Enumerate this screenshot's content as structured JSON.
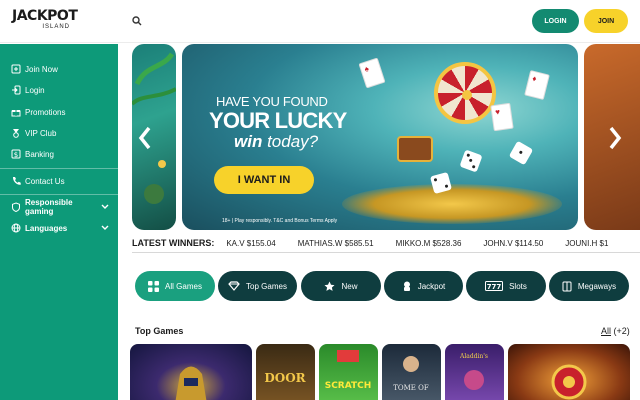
{
  "header": {
    "logo_text": "JACKPOT",
    "logo_sub": "ISLAND",
    "login_label": "LOGIN",
    "join_label": "JOIN"
  },
  "sidebar": {
    "items": [
      {
        "label": "Join Now",
        "icon": "join-icon"
      },
      {
        "label": "Login",
        "icon": "login-icon"
      },
      {
        "label": "Promotions",
        "icon": "gift-icon"
      },
      {
        "label": "VIP Club",
        "icon": "vip-icon"
      },
      {
        "label": "Banking",
        "icon": "banking-icon"
      },
      {
        "label": "Contact Us",
        "icon": "phone-icon"
      },
      {
        "label": "Responsible gaming",
        "icon": "shield-icon"
      },
      {
        "label": "Languages",
        "icon": "globe-icon"
      }
    ]
  },
  "banner": {
    "line1": "HAVE YOU FOUND",
    "line2": "YOUR LUCKY",
    "line3_bold": "win",
    "line3_rest": " today?",
    "cta": "I WANT IN",
    "fine_print": "18+ | Play responsibly. T&C and Bonus Terms Apply"
  },
  "winners": {
    "label": "LATEST WINNERS:",
    "entries": [
      "KA.V  $155.04",
      "MATHIAS.W  $585.51",
      "MIKKO.M  $528.36",
      "JOHN.V  $114.50",
      "JOUNI.H  $1"
    ]
  },
  "categories": [
    {
      "label": "All Games",
      "icon": "grid-icon"
    },
    {
      "label": "Top Games",
      "icon": "diamond-icon"
    },
    {
      "label": "New",
      "icon": "star-icon"
    },
    {
      "label": "Jackpot",
      "icon": "jackpot-icon"
    },
    {
      "label": "Slots",
      "icon": "slots-icon"
    },
    {
      "label": "Megaways",
      "icon": "megaways-icon"
    }
  ],
  "top_games": {
    "title": "Top Games",
    "all_label": "All",
    "count_label": "(+2)"
  },
  "colors": {
    "sidebar": "#0d9a79",
    "login_button": "#138a71",
    "join_button": "#f7d22a",
    "category_pill": "#0f3d3f",
    "category_active": "#1aa07f"
  }
}
